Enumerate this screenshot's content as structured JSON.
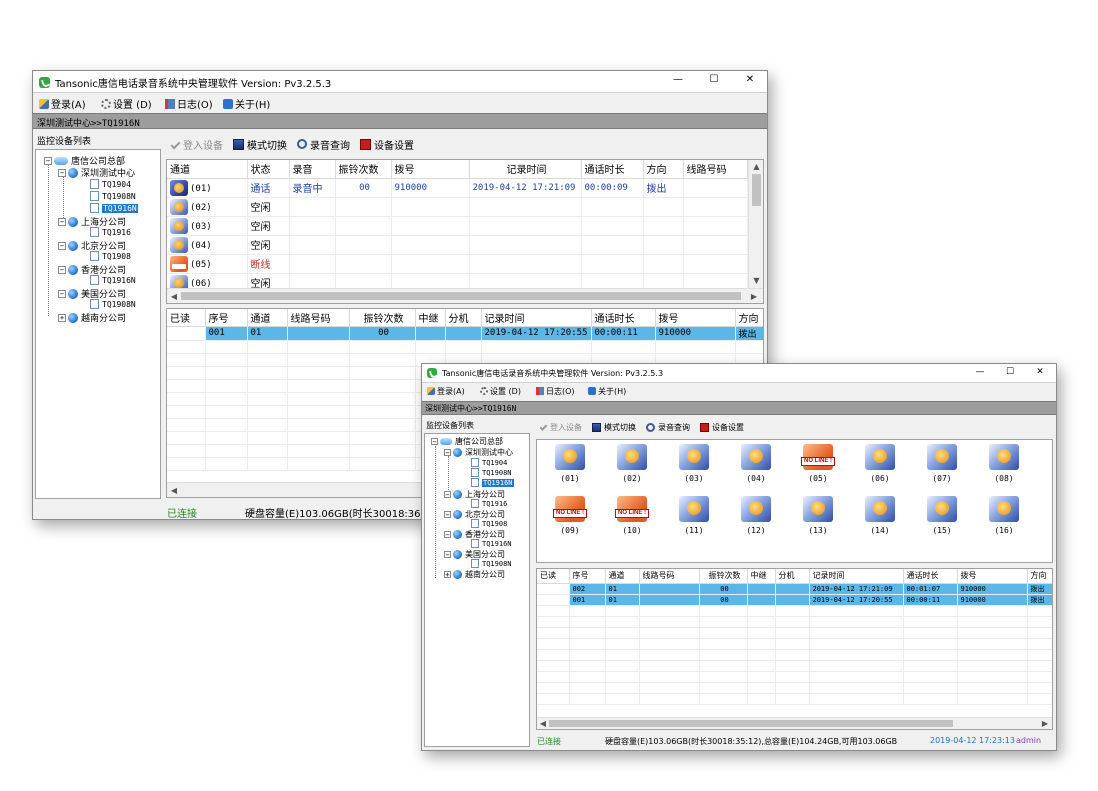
{
  "app": {
    "title": "Tansonic唐信电话录音系统中央管理软件 Version: Pv3.2.5.3",
    "window_controls": {
      "minimize": "—",
      "maximize": "☐",
      "close": "✕"
    }
  },
  "menu": [
    {
      "label": "登录(A)",
      "icon": "login-icon"
    },
    {
      "label": "设置 (D)",
      "icon": "gear-icon"
    },
    {
      "label": "日志(O)",
      "icon": "log-icon"
    },
    {
      "label": "关于(H)",
      "icon": "about-icon"
    }
  ],
  "path": "深圳测试中心>>TQ1916N",
  "tree": {
    "panel_label": "监控设备列表",
    "root": "唐信公司总部",
    "branches": [
      {
        "name": "深圳测试中心",
        "devices": [
          "TQ1904",
          "TQ1908N",
          "TQ1916N"
        ]
      },
      {
        "name": "上海分公司",
        "devices": [
          "TQ1916"
        ]
      },
      {
        "name": "北京分公司",
        "devices": [
          "TQ1908"
        ]
      },
      {
        "name": "香港分公司",
        "devices": [
          "TQ1916N"
        ]
      },
      {
        "name": "美国分公司",
        "devices": [
          "TQ1908N"
        ]
      },
      {
        "name": "越南分公司",
        "devices": []
      }
    ]
  },
  "toolbar": {
    "login_device": "登入设备",
    "mode_switch": "模式切换",
    "record_query": "录音查询",
    "device_settings": "设备设置"
  },
  "channel_grid": {
    "columns": [
      "通道",
      "状态",
      "录音",
      "振铃次数",
      "拨号",
      "记录时间",
      "通话时长",
      "方向",
      "线路号码"
    ],
    "rows": [
      {
        "channel": "(01)",
        "status": "通话",
        "recording": "录音中",
        "rings": "00",
        "dialed": "910000",
        "time": "2019-04-12 17:21:09",
        "duration": "00:00:09",
        "direction": "拨出",
        "line": ""
      },
      {
        "channel": "(02)",
        "status": "空闲",
        "recording": "",
        "rings": "",
        "dialed": "",
        "time": "",
        "duration": "",
        "direction": "",
        "line": ""
      },
      {
        "channel": "(03)",
        "status": "空闲",
        "recording": "",
        "rings": "",
        "dialed": "",
        "time": "",
        "duration": "",
        "direction": "",
        "line": ""
      },
      {
        "channel": "(04)",
        "status": "空闲",
        "recording": "",
        "rings": "",
        "dialed": "",
        "time": "",
        "duration": "",
        "direction": "",
        "line": ""
      },
      {
        "channel": "(05)",
        "status": "断线",
        "recording": "",
        "rings": "",
        "dialed": "",
        "time": "",
        "duration": "",
        "direction": "",
        "line": ""
      },
      {
        "channel": "(06)",
        "status": "空闲",
        "recording": "",
        "rings": "",
        "dialed": "",
        "time": "",
        "duration": "",
        "direction": "",
        "line": ""
      }
    ]
  },
  "record_grid": {
    "columns": [
      "已读",
      "序号",
      "通道",
      "线路号码",
      "振铃次数",
      "中继",
      "分机",
      "记录时间",
      "通话时长",
      "拨号",
      "方向"
    ],
    "rows_back": [
      {
        "read": "",
        "seq": "001",
        "channel": "01",
        "line": "",
        "rings": "00",
        "trunk": "",
        "ext": "",
        "time": "2019-04-12 17:20:55",
        "duration": "00:00:11",
        "dialed": "910000",
        "direction": "拨出"
      }
    ],
    "rows_front": [
      {
        "read": "",
        "seq": "002",
        "channel": "01",
        "line": "",
        "rings": "00",
        "trunk": "",
        "ext": "",
        "time": "2019-04-12 17:21:09",
        "duration": "00:01:07",
        "dialed": "910000",
        "direction": "拨出"
      },
      {
        "read": "",
        "seq": "001",
        "channel": "01",
        "line": "",
        "rings": "00",
        "trunk": "",
        "ext": "",
        "time": "2019-04-12 17:20:55",
        "duration": "00:00:11",
        "dialed": "910000",
        "direction": "拨出"
      }
    ]
  },
  "tiles": [
    {
      "label": "(01)",
      "state": "idle"
    },
    {
      "label": "(02)",
      "state": "idle"
    },
    {
      "label": "(03)",
      "state": "idle"
    },
    {
      "label": "(04)",
      "state": "idle"
    },
    {
      "label": "(05)",
      "state": "noline"
    },
    {
      "label": "(06)",
      "state": "idle"
    },
    {
      "label": "(07)",
      "state": "idle"
    },
    {
      "label": "(08)",
      "state": "idle"
    },
    {
      "label": "(09)",
      "state": "noline"
    },
    {
      "label": "(10)",
      "state": "noline"
    },
    {
      "label": "(11)",
      "state": "idle"
    },
    {
      "label": "(12)",
      "state": "idle"
    },
    {
      "label": "(13)",
      "state": "idle"
    },
    {
      "label": "(14)",
      "state": "idle"
    },
    {
      "label": "(15)",
      "state": "idle"
    },
    {
      "label": "(16)",
      "state": "idle"
    }
  ],
  "noline_text": "NO LINE !",
  "status": {
    "connected": "已连接",
    "disk_back": "硬盘容量(E)103.06GB(时长30018:36:16),",
    "disk_front": "硬盘容量(E)103.06GB(时长30018:35:12),总容量(E)104.24GB,可用103.06GB",
    "datetime": "2019-04-12 17:23:13",
    "user": "admin"
  },
  "colors": {
    "selection": "#5ab7e8",
    "status_ok": "#1e8a1e",
    "status_blue": "#1c3fa8",
    "status_red": "#d8211c",
    "datetime": "#1c6fd1",
    "user": "#7a3fb0"
  }
}
